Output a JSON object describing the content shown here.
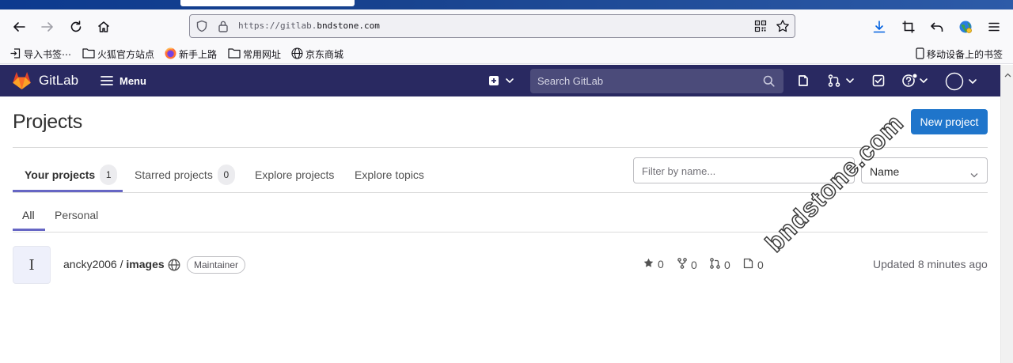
{
  "browser": {
    "url_prefix": "https://gitlab.",
    "url_domain": "bndstone.com",
    "bookmarks": [
      "导入书签⋯",
      "火狐官方站点",
      "新手上路",
      "常用网址",
      "京东商城"
    ],
    "mobile_bookmarks": "移动设备上的书签"
  },
  "nav": {
    "brand": "GitLab",
    "menu": "Menu",
    "search_placeholder": "Search GitLab"
  },
  "page": {
    "title": "Projects",
    "new_project": "New project",
    "tabs": [
      {
        "label": "Your projects",
        "count": "1"
      },
      {
        "label": "Starred projects",
        "count": "0"
      },
      {
        "label": "Explore projects"
      },
      {
        "label": "Explore topics"
      }
    ],
    "filter_placeholder": "Filter by name...",
    "sort_value": "Name",
    "subtabs": [
      "All",
      "Personal"
    ]
  },
  "project": {
    "avatar_letter": "I",
    "namespace": "ancky2006 / ",
    "name": "images",
    "role": "Maintainer",
    "stars": "0",
    "forks": "0",
    "merge_requests": "0",
    "issues": "0",
    "updated": "Updated 8 minutes ago"
  },
  "watermark": "bndstone.com",
  "colors": {
    "nav_bg": "#292961",
    "primary": "#1f75cb",
    "tab_underline": "#6666c4"
  }
}
